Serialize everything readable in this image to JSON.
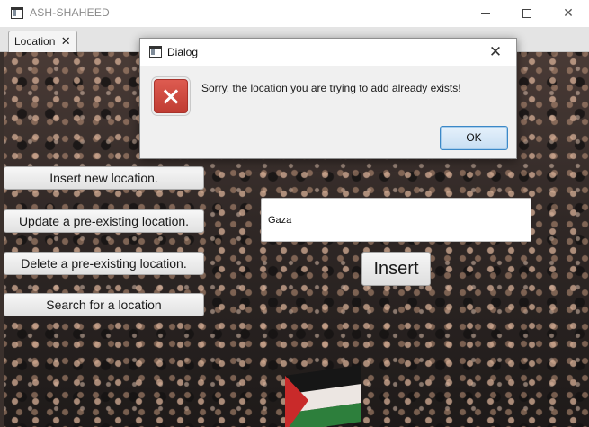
{
  "window": {
    "title": "ASH-SHAHEED",
    "controls": {
      "minimize": "minimize-icon",
      "maximize": "maximize-icon",
      "close": "close-icon"
    }
  },
  "tabs": [
    {
      "label": "Location",
      "close_glyph": "✕"
    }
  ],
  "actions": {
    "insert_new": "Insert new location.",
    "update": "Update a pre-existing location.",
    "delete": "Delete a pre-existing location.",
    "search": "Search for a location"
  },
  "form": {
    "location_value": "Gaza",
    "insert_label": "Insert"
  },
  "dialog": {
    "title": "Dialog",
    "message": "Sorry, the location you are trying to add already exists!",
    "ok_label": "OK",
    "close_glyph": "✕",
    "icon": "error-icon"
  },
  "colors": {
    "error_red": "#c9473d",
    "ok_accent": "#3c88c7",
    "flag_red": "#c92a2a",
    "flag_green": "#2d7f3c"
  }
}
